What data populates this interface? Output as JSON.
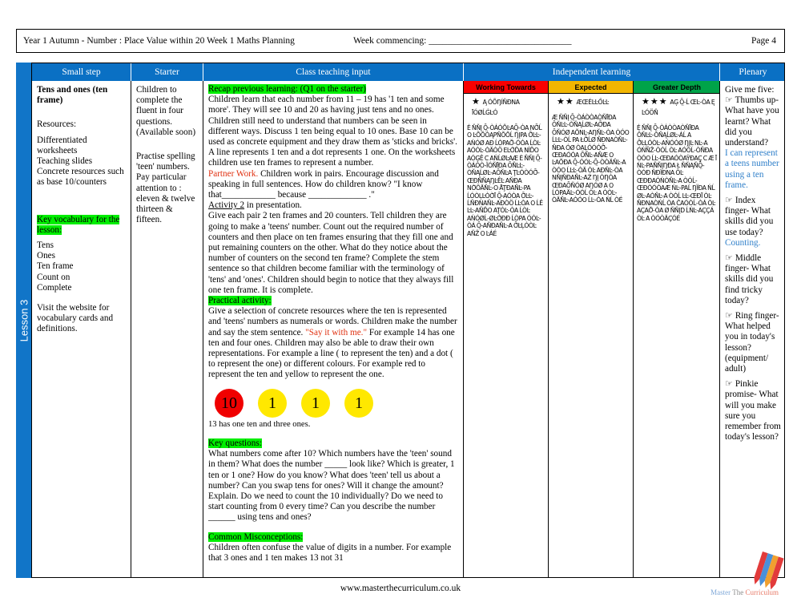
{
  "header": {
    "title": "Year 1 Autumn -  Number : Place Value within 20 Week 1 Maths Planning",
    "week_commencing": "Week commencing: _______________________________",
    "page": "Page 4"
  },
  "lesson_tab": {
    "label": "Lesson 3"
  },
  "columns": {
    "small_step": "Small step",
    "starter": "Starter",
    "class_teaching_input": "Class teaching input",
    "independent_learning": "Independent learning",
    "plenary": "Plenary"
  },
  "independent_levels": {
    "working_towards": "Working Towards",
    "expected": "Expected",
    "greater_depth": "Greater Depth"
  },
  "colors": {
    "header_blue": "#0a70c4",
    "tab_blue": "#1175c8",
    "working_towards": "#f90000",
    "expected": "#f2b600",
    "greater_depth": "#00a349",
    "highlight_green": "#00ee00",
    "red_text": "#e03010",
    "blue_text": "#2f7fc9",
    "counter_red": "#f00000",
    "counter_yellow": "#ffe800"
  },
  "small_step": {
    "title": "Tens and ones (ten frame)",
    "resources_label": "Resources:",
    "resources": "Differentiated worksheets\nTeaching slides\nConcrete resources such as base 10/counters",
    "key_vocab_label": "Key vocabulary for the lesson:",
    "vocab": "Tens\nOnes\nTen frame\nCount on\nComplete",
    "visit": "Visit the website for vocabulary cards and definitions."
  },
  "starter": {
    "para1": "Children to complete the fluent in four questions. (Available soon)",
    "para2": "Practise spelling 'teen' numbers. Pay particular attention to : eleven & twelve thirteen & fifteen."
  },
  "class_teaching": {
    "recap_heading": "Recap previous learning: (Q1 on the starter)",
    "recap_body": "Children learn that each number from 11 – 19 has  '1 ten and some more'. They will see 10 and 20 as having just tens and no ones. Children still need to understand that numbers can be seen in different ways. Discuss 1 ten being equal to 10 ones. Base 10 can be used as concrete equipment and they draw them as 'sticks and bricks'. A line represents 1 ten and a dot represents 1 one. On the worksheets children use ten frames to represent a number.",
    "partner_work_label": "Partner Work.",
    "partner_work_body": " Children work  in pairs. Encourage discussion and speaking in full sentences. How do children know?  \"I know that____________ because _____________ .\"",
    "activity2_label": "Activity 2",
    "activity2_body": " in presentation.",
    "activity2_text": "Give each pair 2 ten frames and 20 counters. Tell children they are going to make a 'teens' number. Count out the required number of counters and then place on ten frames ensuring that they fill one and put remaining counters on the other. What do they notice about the number of counters on the second ten frame? Complete the stem sentence so that children become familiar with the terminology of 'tens' and 'ones'. Children should begin to notice that they always fill one ten frame. It is complete.",
    "practical_heading": "Practical activity:",
    "practical_body_1": "Give a selection of concrete resources where the ten is represented and 'teens' numbers as numerals or words. Children make the number and say the stem sentence. ",
    "practical_quote": "\"Say it with me.\"",
    "practical_body_2": " For example 14 has one ten and four ones. Children may also be able to draw their own representations. For example a line ( to represent the ten) and a dot ( to represent the one) or different colours. For example red to represent the ten and yellow to represent the one.",
    "counters": [
      {
        "value": "10",
        "color": "red"
      },
      {
        "value": "1",
        "color": "yellow"
      },
      {
        "value": "1",
        "color": "yellow"
      },
      {
        "value": "1",
        "color": "yellow"
      }
    ],
    "counters_caption": "13 has one ten and three ones.",
    "key_questions_heading": "Key questions:",
    "key_questions_body": "What numbers come after 10? Which numbers have the 'teen' sound in them? What does the number _____ look like? Which is greater, 1 ten or 1 one? How do you know? What does 'teen' tell us about a number? Can you swap tens for ones? Will it change the amount? Explain. Do we need to count the 10 individually? Do we need to start counting from 0 every time? Can  you describe the number ______ using tens and ones?",
    "misconceptions_heading": "Common Misconceptions:",
    "misconceptions_body": "Children often confuse the value of digits in a number. For example that 3 ones and 1 ten makes 13 not 31"
  },
  "independent": {
    "working_towards": {
      "stars": "★",
      "star_count": 1,
      "heading_garbled": "A̧  ÓÕŊÍŇÐNA ĪÓØĹĠĿÓ",
      "body_garbled": "Ė ŇŇĮ Ō̤-ÒÁÓŎĿAŌ̤-ÒA NŌ̈Ĺ O ĿÕŎÓĄPŇŎŎĹ ŊĮPA Ō̄ĿĿ-AŃÓØ AÐ ĹÒPAŎ̈-ÓÓA ĹÒĿ AÓÓĿ-ÒÄÒÖ EĿÓ̄ĎA NÌĎO AÓĢÊ C AŃĹØĿAÆ Ė ŇŇĮ Ō̤-ÒÁÒÒ-ÏÓŇĪÐA ŌŇĿĿ-ÒŇĄĹØĿ-AŌŇĿA ŢĿÓÒÓŌ̄-ŒÐŇŇĄŊĿÊĿ AŇÐA NÒ̈ÖÄŇĿ-O ĀŢÐAŇĿ-PA ĹÓÒĻĿÒÒ̄Ī Ō̤-AÓÒA Ō̄ĿĿ-ĹŇÐNAŇĿ-AÐÒÖ ĹĿÒA O ĹÊ ĿĿ-AŇĎO AŢÓĿ-ÒA ĹÒĿ AŃÓØĹ-ØĿÓ̄ĐÐ ĹÒPA ÓÓĿ-ÒÁ Ō̤-AŇÐAŇĿ-A Ō̄ĿĻÓÒĿ AŇŽ O ĿÁÉ"
    },
    "expected": {
      "stars": "★★",
      "star_count": 2,
      "heading_garbled": "ÆŒÉĿĿŐĿĿ",
      "body_garbled": "Æ ŇŇĮ Ō̤-ÒÁÒÒAÒŇĪÐA ŌŇĿĿ-ÒŇĄĹØĿ-AŌ̈ÐA ŌŇÓØ AŎNĿ-AŊŇĿ-ÒA ÒÓO ĹĿĿ-ÒĹ PA ŁŌ̄ĹØ ŇÐNAÒŇĿ-ŇÐA ÓØ ÒAĻÓÓÓŌ̄-ŒÐAÓÓA ŌŇĿ-AŇÆ O ĿAŎÐA Ō̤-ÓÓĿ-Ō̤-ÒÒÄŇĿ-A ÒÓO ĹĿĿ-ÒÄ ÒĿ AÐŇĿ-ÒA NŇĮŇÐAŇĿ-AŹ ŊĮ ÒŊÒA ŒÐAŌŇÓØ AŊÓØ A O ĹÒPAÄĿ-ÒÓĹ ÒĿ A ÓÒĿ-ÒÄŇĿ-AÒÓO ĹĿ-ÒA ŃĹ ÒÉ"
    },
    "greater_depth": {
      "stars": "★★★",
      "star_count": 3,
      "heading_garbled": "AĢ Ō̤-Ĺ ŒĿ-ÒA Ę ĿÓÖŇ",
      "body_garbled": "Ė ŇŇĮ Ō̤-ÒÁÒÒAÒŇĪÐA ŌŇĿĿ-ÒŇĄĹØĿ-ÁĹ A Ō̄ĿĻÓÒĿ-AŃÓÓØ ŊĮĿ NĿ-A ÓŃŇŽ-ÒÓĹ ÒĿ AÓÒĹ-ÒŇÐA ÒÓO ĹĿ-ŒÐAÓÒAŸÐAÇ C Æ Ī ŃĿ-PAŇŇĮŊÐA Ł ŇŇĄŇŌ̤-ÒÓÐ ŇÐÏÐNA ŌĿ ŒÐÐAÓŃÒŇĿ-A ÒÓĹ-ŒÐÒÓÒAÆ ŃĿ-PAĹ ŊÏÐA ŃĹ ØĿ-AÒŇĿ-A ÒÓĹ ĿĿ-ŒÐĪ ÒĿ ŇÐNAÒŃĹ ÒA ČAÓÒĹ-ÒÁ ÒĿ AÇAŎ̈-ÒA Ø ŇŇĮD ĹŃĿ-AÇÇÁ ÒĿ A ÒÓÒÄÇÓÉ"
    }
  },
  "plenary": {
    "intro": "Give me five:",
    "items": [
      {
        "icon": "hand-icon",
        "text": "Thumbs up- What have you learnt? What did you understand?",
        "answer": "I can represent a teens number using a ten frame."
      },
      {
        "icon": "hand-icon",
        "text": "Index finger- What skills did you use today?",
        "answer": "Counting."
      },
      {
        "icon": "hand-icon",
        "text": "Middle finger- What skills did you find tricky today?",
        "answer": ""
      },
      {
        "icon": "hand-icon",
        "text": "Ring finger- What helped you in today's lesson? (equipment/ adult)",
        "answer": ""
      },
      {
        "icon": "hand-icon",
        "text": "Pinkie promise- What will you make sure you remember from today's lesson?",
        "answer": ""
      }
    ]
  },
  "footer": {
    "url": "www.masterthecurriculum.co.uk",
    "logo_words": [
      "Master",
      "The",
      "Curriculum"
    ]
  }
}
